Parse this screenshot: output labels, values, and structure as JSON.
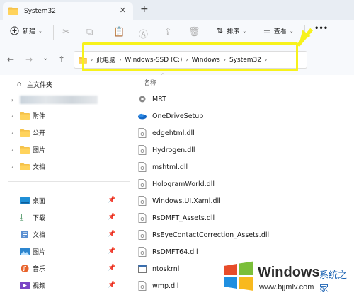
{
  "window": {
    "tab_title": "System32",
    "close_glyph": "✕",
    "new_tab_glyph": "+"
  },
  "toolbar": {
    "new_label": "新建",
    "sort_label": "排序",
    "view_label": "查看",
    "more_glyph": "•••"
  },
  "address": {
    "crumbs": [
      "此电脑",
      "Windows-SSD (C:)",
      "Windows",
      "System32"
    ],
    "chevron": "›",
    "highlight_color": "#f7f21b"
  },
  "sidebar": {
    "home_label": "主文件夹",
    "tree_items": [
      {
        "label": "附件"
      },
      {
        "label": "公开"
      },
      {
        "label": "图片"
      },
      {
        "label": "文档"
      }
    ],
    "quick_access": [
      {
        "label": "桌面",
        "icon": "desktop-icon"
      },
      {
        "label": "下载",
        "icon": "download-icon"
      },
      {
        "label": "文档",
        "icon": "document-icon"
      },
      {
        "label": "图片",
        "icon": "picture-icon"
      },
      {
        "label": "音乐",
        "icon": "music-icon"
      },
      {
        "label": "视频",
        "icon": "video-icon"
      }
    ],
    "pin_glyph": "📌"
  },
  "files": {
    "column_name": "名称",
    "items": [
      {
        "name": "MRT",
        "icon": "gear-file-icon"
      },
      {
        "name": "OneDriveSetup",
        "icon": "onedrive-icon"
      },
      {
        "name": "edgehtml.dll",
        "icon": "dll-file-icon"
      },
      {
        "name": "Hydrogen.dll",
        "icon": "dll-file-icon"
      },
      {
        "name": "mshtml.dll",
        "icon": "dll-file-icon"
      },
      {
        "name": "HologramWorld.dll",
        "icon": "dll-file-icon"
      },
      {
        "name": "Windows.UI.Xaml.dll",
        "icon": "dll-file-icon"
      },
      {
        "name": "RsDMFT_Assets.dll",
        "icon": "dll-file-icon"
      },
      {
        "name": "RsEyeContactCorrection_Assets.dll",
        "icon": "dll-file-icon"
      },
      {
        "name": "RsDMFT64.dll",
        "icon": "dll-file-icon"
      },
      {
        "name": "ntoskrnl",
        "icon": "exe-file-icon"
      },
      {
        "name": "wmp.dll",
        "icon": "dll-file-icon"
      }
    ]
  },
  "watermark": {
    "brand": "Windows",
    "site_cn": "系统之家",
    "url": "www.bjjmlv.com"
  }
}
